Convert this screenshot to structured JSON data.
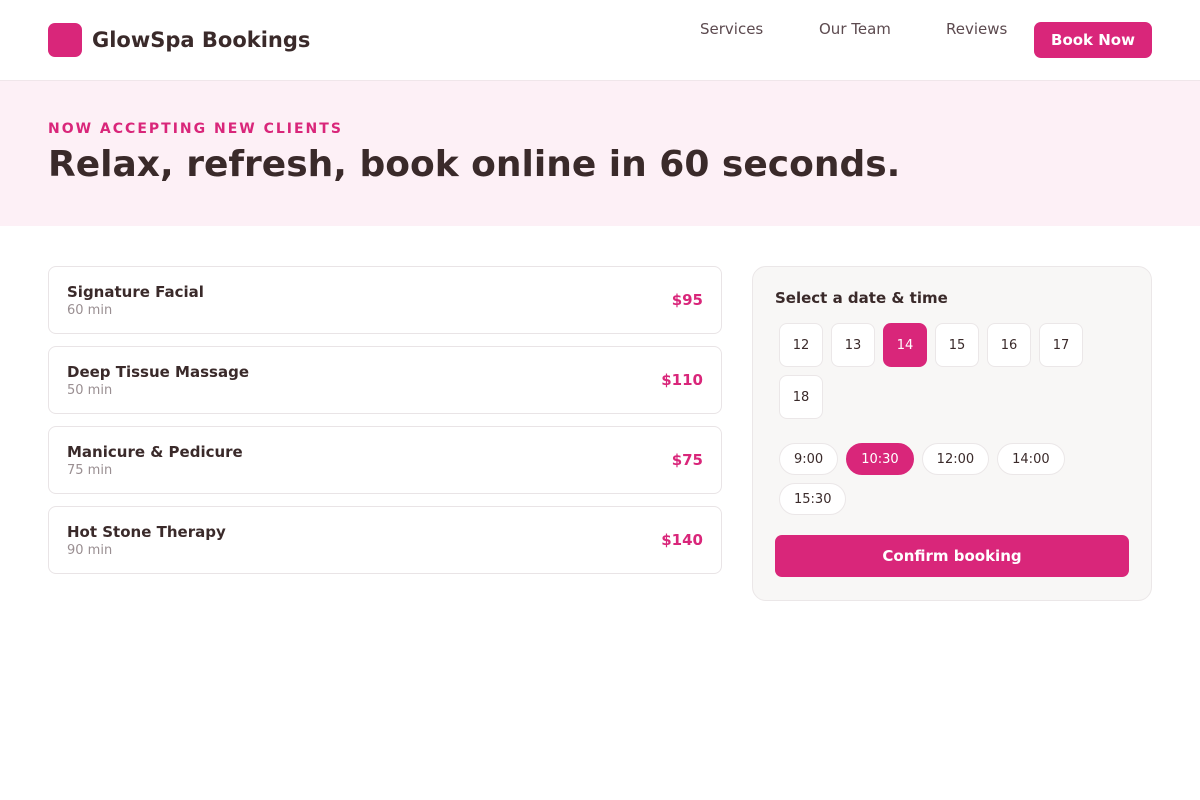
{
  "header": {
    "brand": "GlowSpa Bookings",
    "nav": [
      "Services",
      "Our Team",
      "Reviews"
    ],
    "cta": "Book Now"
  },
  "hero": {
    "eyebrow": "NOW ACCEPTING NEW CLIENTS",
    "title": "Relax, refresh, book online in 60 seconds."
  },
  "services": [
    {
      "name": "Signature Facial",
      "duration": "60 min",
      "price": "$95"
    },
    {
      "name": "Deep Tissue Massage",
      "duration": "50 min",
      "price": "$110"
    },
    {
      "name": "Manicure & Pedicure",
      "duration": "75 min",
      "price": "$75"
    },
    {
      "name": "Hot Stone Therapy",
      "duration": "90 min",
      "price": "$140"
    }
  ],
  "booking": {
    "title": "Select a date & time",
    "dates": [
      "12",
      "13",
      "14",
      "15",
      "16",
      "17",
      "18"
    ],
    "selected_date": "14",
    "times": [
      "9:00",
      "10:30",
      "12:00",
      "14:00",
      "15:30"
    ],
    "selected_time": "10:30",
    "confirm_label": "Confirm booking"
  },
  "colors": {
    "accent": "#d9267a",
    "hero_bg": "#fdf0f6",
    "text": "#3a2a2a"
  }
}
